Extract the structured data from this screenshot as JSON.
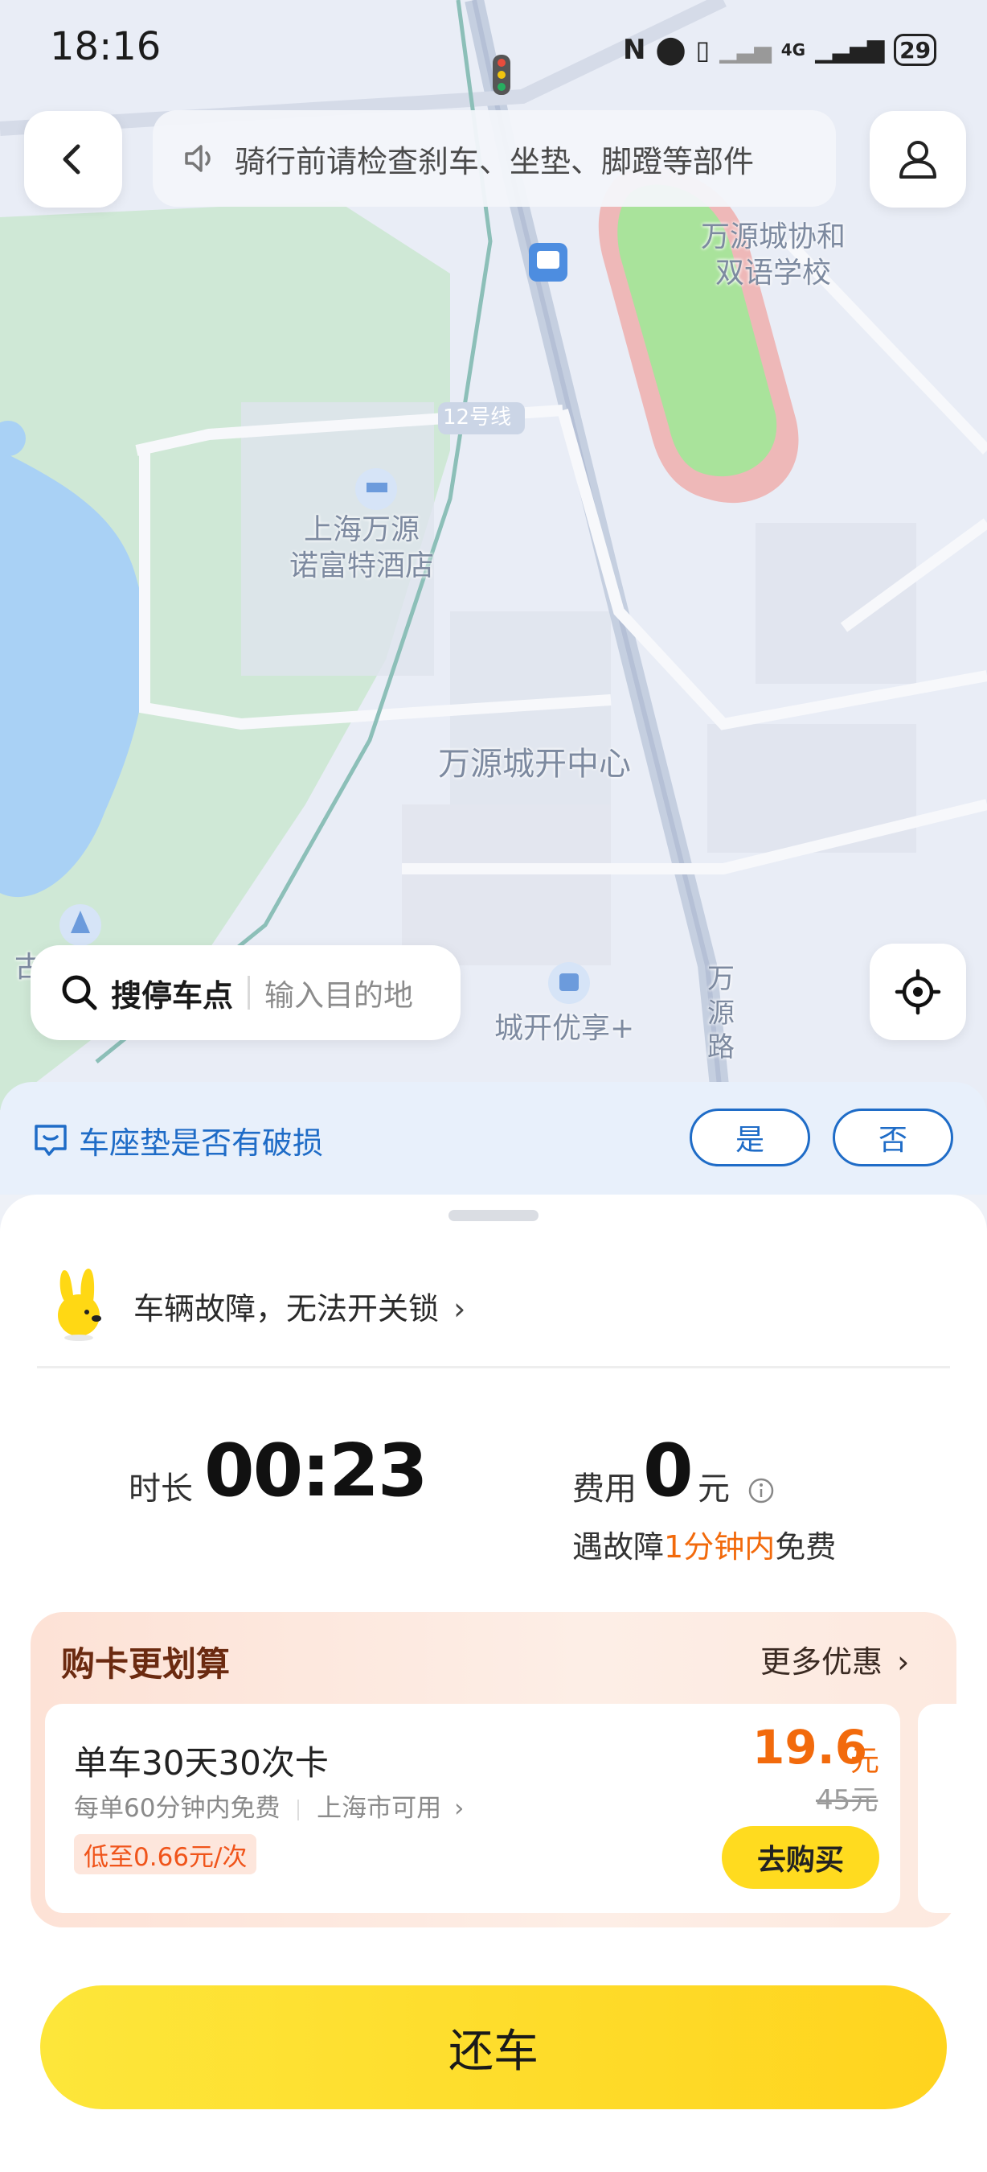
{
  "status_bar": {
    "time": "18:16",
    "battery": "29",
    "network": "4G"
  },
  "header": {
    "notice": "骑行前请检查刹车、坐垫、脚蹬等部件"
  },
  "map": {
    "labels": {
      "school": "万源城协和\n双语学校",
      "line": "12号线",
      "hotel": "上海万源\n诺富特酒店",
      "center": "万源城开中心",
      "mall": "城开优享+",
      "road": "万\n源\n路",
      "edge_left": "古"
    }
  },
  "search": {
    "main": "搜停车点",
    "placeholder": "输入目的地"
  },
  "question": {
    "text": "车座垫是否有破损",
    "yes": "是",
    "no": "否"
  },
  "fault": {
    "text": "车辆故障，无法开关锁"
  },
  "ride": {
    "duration_label": "时长",
    "duration_value": "00:23",
    "fee_label": "费用",
    "fee_value": "0",
    "fee_unit": "元",
    "free_prefix": "遇故障",
    "free_highlight": "1分钟内",
    "free_suffix": "免费"
  },
  "promo": {
    "title": "购卡更划算",
    "more": "更多优惠",
    "plan_name": "单车30天30次卡",
    "plan_desc_1": "每单60分钟内免费",
    "plan_desc_2": "上海市可用",
    "plan_tag": "低至0.66元/次",
    "price": "19.6",
    "price_unit": "元",
    "old_price": "45元",
    "buy": "去购买"
  },
  "actions": {
    "return": "还车"
  },
  "colors": {
    "accent_blue": "#1f6cc7",
    "accent_orange": "#f26a0c",
    "button_yellow": "#ffdb1f"
  }
}
